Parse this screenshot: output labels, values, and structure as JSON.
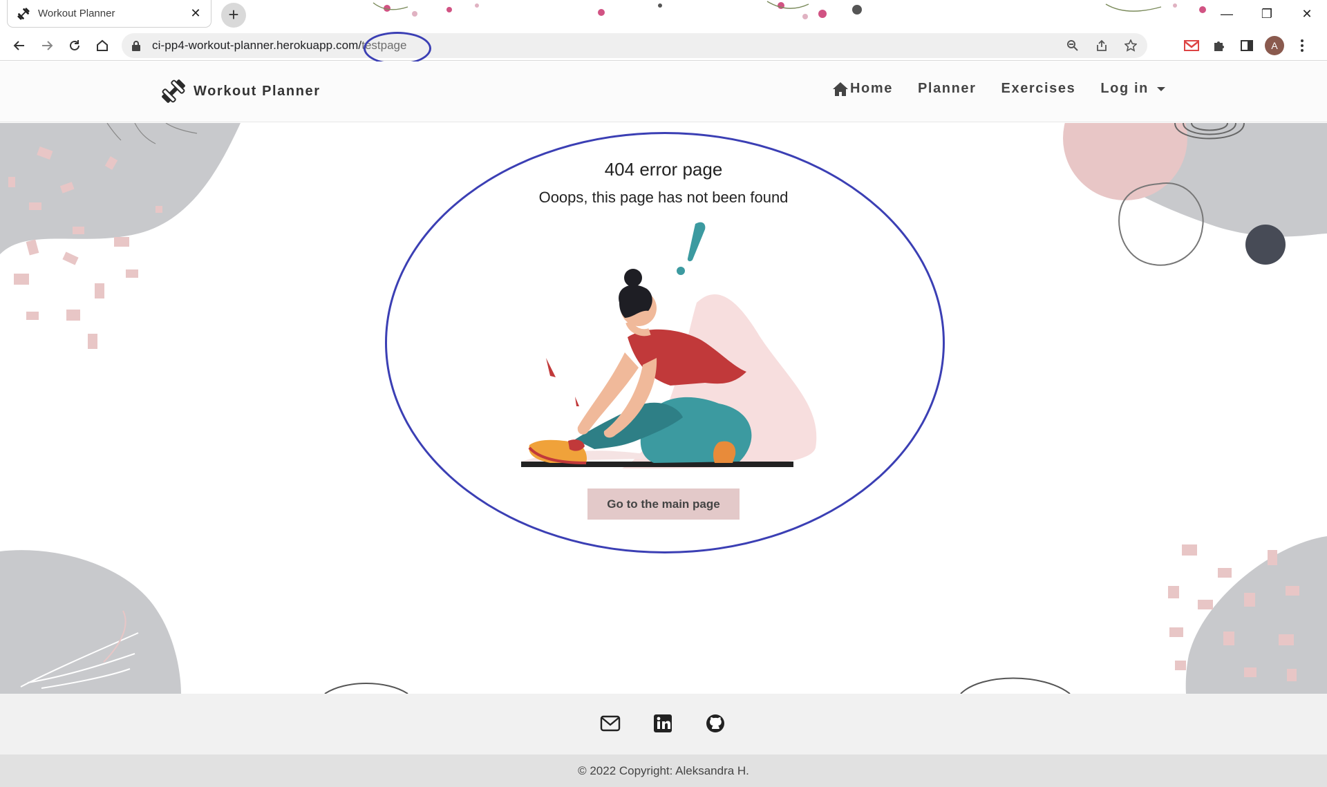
{
  "browser": {
    "tab_title": "Workout Planner",
    "tab_close": "✕",
    "new_tab": "+",
    "url_host": "ci-pp4-workout-planner.herokuapp.com/",
    "url_path": "testpage",
    "profile_initial": "A",
    "window_minimize": "—",
    "window_restore": "❐",
    "window_close": "✕"
  },
  "site_nav": {
    "brand": "Workout Planner",
    "home": "Home",
    "planner": "Planner",
    "exercises": "Exercises",
    "login": "Log in"
  },
  "error": {
    "title": "404 error page",
    "subtitle": "Ooops, this page has not been found",
    "button": "Go to the main page"
  },
  "footer": {
    "copyright": "© 2022 Copyright: Aleksandra H."
  },
  "colors": {
    "annotation": "#3b3fb4",
    "button_bg": "#e3c9c9",
    "deco_grey": "#c8c9cc",
    "deco_pink": "#e8c6c6",
    "deco_dark": "#474b56"
  }
}
